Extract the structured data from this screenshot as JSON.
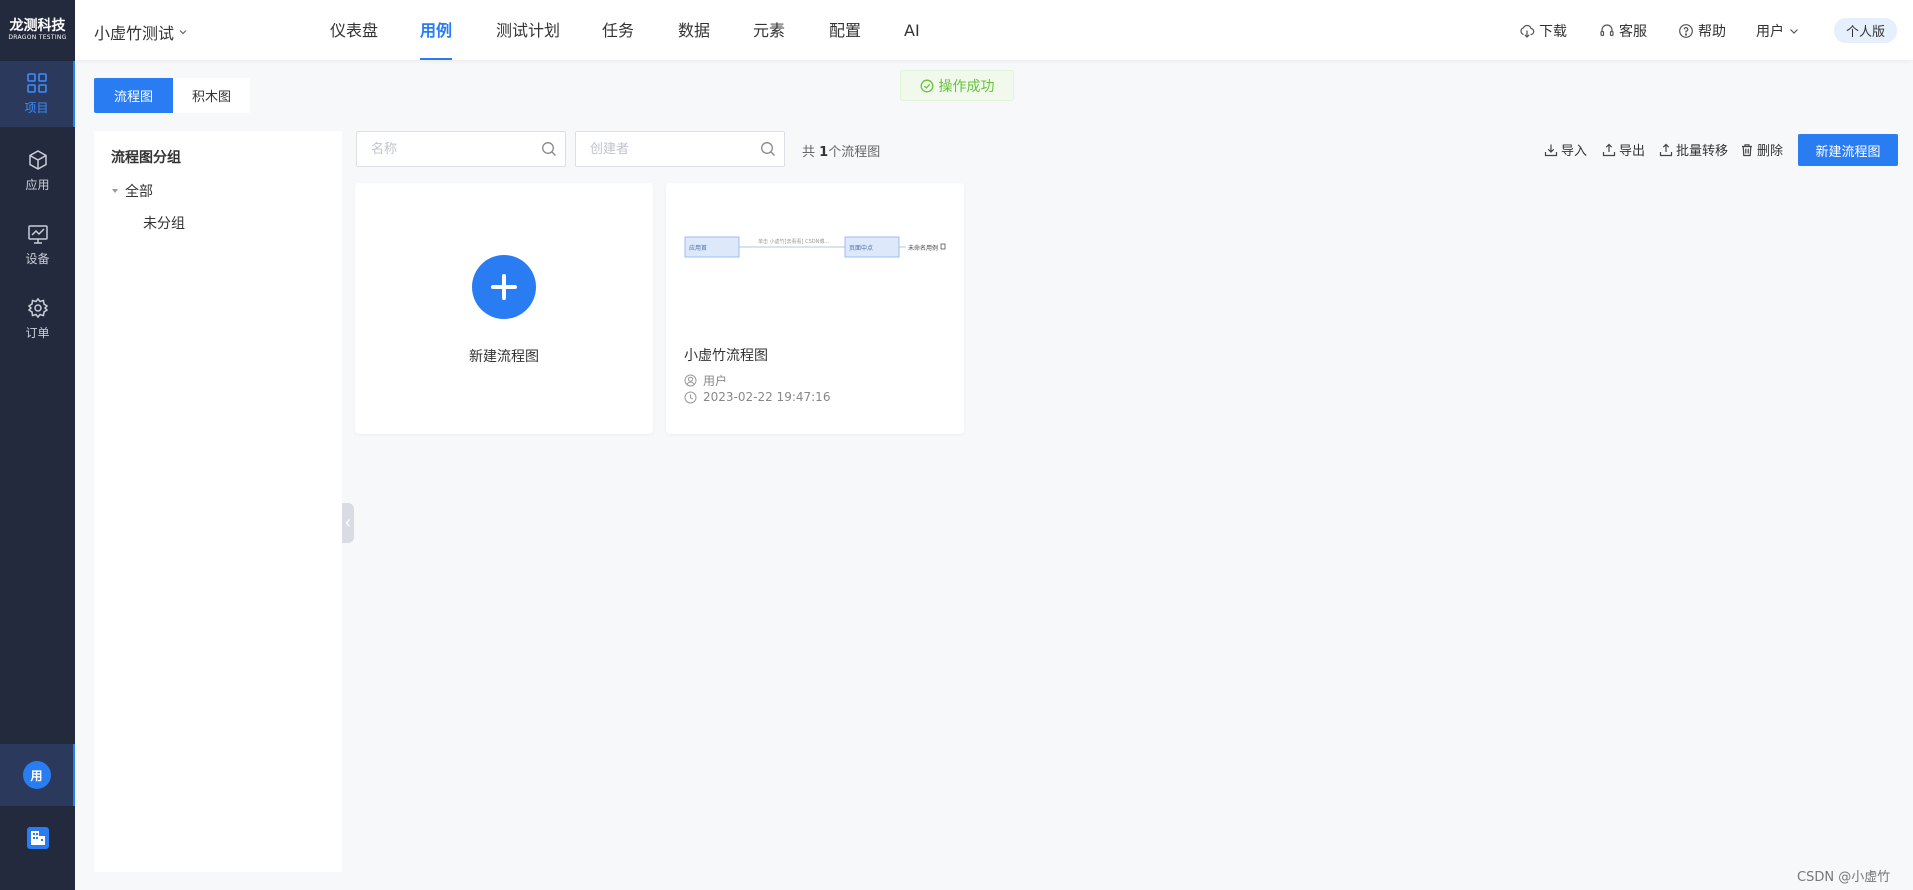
{
  "logo": {
    "line1": "龙测科技",
    "line2": "DRAGON TESTING"
  },
  "sidebar": {
    "items": [
      {
        "label": "项目",
        "icon": "grid-icon",
        "active": true
      },
      {
        "label": "应用",
        "icon": "cube-icon",
        "active": false
      },
      {
        "label": "设备",
        "icon": "monitor-icon",
        "active": false
      },
      {
        "label": "订单",
        "icon": "gear-icon",
        "active": false
      }
    ],
    "avatar_text": "用",
    "org_icon": "building-icon"
  },
  "header": {
    "project_name": "小虚竹测试",
    "tabs": [
      {
        "label": "仪表盘",
        "active": false
      },
      {
        "label": "用例",
        "active": true
      },
      {
        "label": "测试计划",
        "active": false
      },
      {
        "label": "任务",
        "active": false
      },
      {
        "label": "数据",
        "active": false
      },
      {
        "label": "元素",
        "active": false
      },
      {
        "label": "配置",
        "active": false
      },
      {
        "label": "AI",
        "active": false
      }
    ],
    "download": "下载",
    "service": "客服",
    "help": "帮助",
    "user": "用户",
    "edition": "个人版"
  },
  "toast": {
    "text": "操作成功"
  },
  "view_switch": {
    "flow": "流程图",
    "blocks": "积木图",
    "active": "流程图"
  },
  "groups": {
    "title": "流程图分组",
    "root": "全部",
    "children": [
      "未分组"
    ]
  },
  "toolbar": {
    "name_placeholder": "名称",
    "creator_placeholder": "创建者",
    "count_prefix": "共 ",
    "count": "1",
    "count_suffix": "个流程图",
    "import": "导入",
    "export": "导出",
    "batch_move": "批量转移",
    "delete": "删除",
    "new_flow": "新建流程图"
  },
  "cards": {
    "new_label": "新建流程图",
    "flows": [
      {
        "name": "小虚竹流程图",
        "creator": "用户",
        "time": "2023-02-22 19:47:16",
        "thumbnail": {
          "node1": "应用首",
          "edge": "单击 小虚竹[去看看] CSDN博...",
          "node2": "页面中点",
          "node3": "未命名用例"
        }
      }
    ]
  },
  "watermark": "CSDN @小虚竹",
  "colors": {
    "primary": "#2a7cf3",
    "sidebar": "#232a3d",
    "success": "#67c23a"
  }
}
